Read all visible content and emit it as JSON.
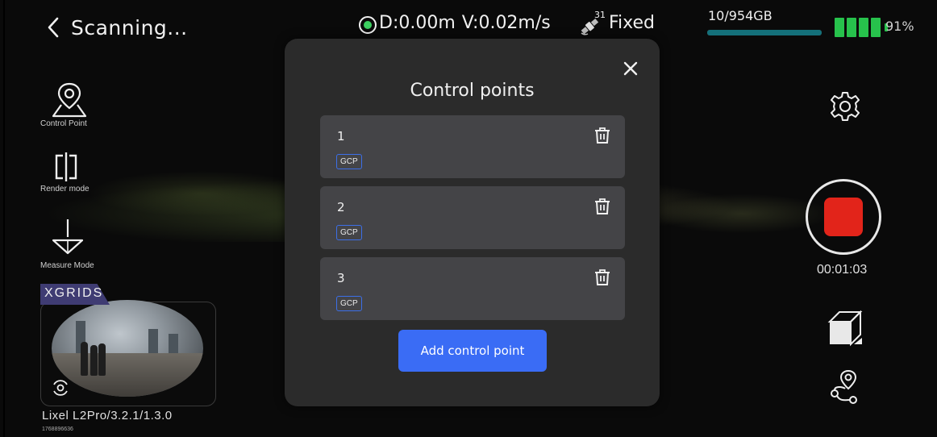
{
  "header": {
    "back_label": "Scanning...",
    "distance": "D:0.00m",
    "velocity": "V:0.02m/s",
    "satellite_count": "31",
    "gnss_status": "Fixed",
    "storage_text": "10/954GB",
    "storage_used_fraction": 0.01,
    "battery_percent": "91%"
  },
  "tools": [
    {
      "label": "Control Point",
      "icon": "map-pin-icon"
    },
    {
      "label": "Render mode",
      "icon": "split-bracket-icon"
    },
    {
      "label": "Measure Mode",
      "icon": "measure-icon"
    }
  ],
  "camera": {
    "brand": "XGRIDS",
    "device_version": "Lixel L2Pro/3.2.1/1.3.0",
    "device_id": "1768896636"
  },
  "recording": {
    "elapsed": "00:01:03",
    "record_color": "#e2241a"
  },
  "modal": {
    "title": "Control points",
    "items": [
      {
        "number": "1",
        "tag": "GCP"
      },
      {
        "number": "2",
        "tag": "GCP"
      },
      {
        "number": "3",
        "tag": "GCP"
      }
    ],
    "add_button_label": "Add control point",
    "accent_color": "#3a6cf5"
  }
}
